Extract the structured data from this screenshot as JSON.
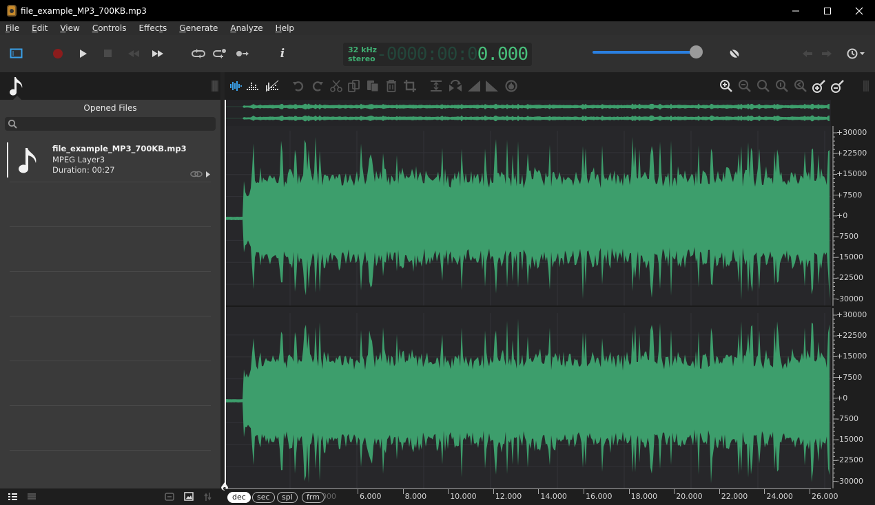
{
  "window": {
    "title": "file_example_MP3_700KB.mp3",
    "app_icon": "audio-editor-app-icon",
    "controls": {
      "minimize": "—",
      "maximize": "☐",
      "close": "✕"
    }
  },
  "menu": [
    {
      "label": "File",
      "mnemonic": "F"
    },
    {
      "label": "Edit",
      "mnemonic": "E"
    },
    {
      "label": "View",
      "mnemonic": "V"
    },
    {
      "label": "Controls",
      "mnemonic": "C"
    },
    {
      "label": "Effects",
      "mnemonic": "t"
    },
    {
      "label": "Generate",
      "mnemonic": "G"
    },
    {
      "label": "Analyze",
      "mnemonic": "A"
    },
    {
      "label": "Help",
      "mnemonic": "H"
    }
  ],
  "transport": {
    "buttons": [
      "toggle-sidebar",
      "record",
      "play",
      "stop",
      "rewind",
      "fast-forward",
      "loop",
      "loop-from-marker",
      "play-from-marker",
      "info"
    ],
    "info_label": "i",
    "lcd": {
      "sample_rate": "32 kHz",
      "channels": "stereo",
      "time_dim": "-0000:00:0",
      "time_lit": "0.000"
    },
    "volume_percent": 100,
    "history_label": "history"
  },
  "sidebar": {
    "title": "Opened Files",
    "search_placeholder": "",
    "files": [
      {
        "name": "file_example_MP3_700KB.mp3",
        "format": "MPEG Layer3",
        "duration": "Duration: 00:27"
      }
    ]
  },
  "edit_toolbar": {
    "view_modes": [
      "waveform",
      "spectrum",
      "spectrum-off"
    ],
    "edit": [
      "undo",
      "redo",
      "cut",
      "copy",
      "paste",
      "delete",
      "crop"
    ],
    "effects": [
      "normalize",
      "reverse",
      "fade-in",
      "fade-out",
      "amplify"
    ],
    "zoom": [
      "zoom-in",
      "zoom-out",
      "zoom-fit",
      "zoom-selection",
      "zoom-previous",
      "zoom-in-vertical",
      "zoom-out-vertical"
    ]
  },
  "waveform": {
    "colors": {
      "wave": "#3d9e6c",
      "background": "#27272a",
      "accent": "#2a7fe0"
    },
    "channels": 2,
    "y_ticks": [
      "+30000",
      "+22500",
      "+15000",
      "+7500",
      "+0",
      "-7500",
      "-15000",
      "-22500",
      "-30000"
    ],
    "x_ticks": [
      "6.000",
      "8.000",
      "10.000",
      "12.000",
      "14.000",
      "16.000",
      "18.000",
      "20.000",
      "22.000",
      "24.000",
      "26.000"
    ],
    "x_partial": "000",
    "duration_seconds": 27
  },
  "time_format": {
    "options": [
      "dec",
      "sec",
      "spl",
      "frm"
    ],
    "selected": "dec"
  }
}
